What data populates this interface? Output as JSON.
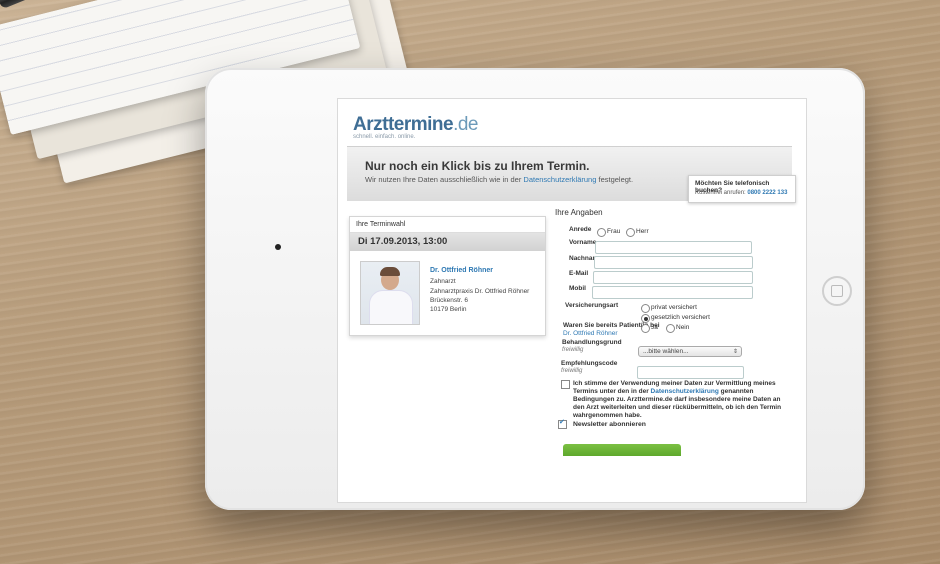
{
  "logo": {
    "brand": "Arzttermine",
    "tld": ".de",
    "tagline": "schnell. einfach. online."
  },
  "banner": {
    "title": "Nur noch ein Klick bis zu Ihrem Termin.",
    "sub_prefix": "Wir nutzen Ihre Daten ausschließlich wie in der",
    "sub_link": "Datenschutzerklärung",
    "sub_suffix": "festgelegt."
  },
  "phone_box": {
    "question": "Möchten Sie telefonisch buchen?",
    "label": "Kostenfrei anrufen:",
    "number": "0800 2222 133"
  },
  "appointment": {
    "header": "Ihre Terminwahl",
    "date": "Di 17.09.2013, 13:00",
    "doctor_name": "Dr. Ottfried Röhner",
    "specialty": "Zahnarzt",
    "practice": "Zahnarztpraxis Dr. Ottfried Röhner",
    "street": "Brückenstr. 6",
    "city": "10179 Berlin"
  },
  "form": {
    "title": "Ihre Angaben",
    "anrede_label": "Anrede",
    "anrede_opt1": "Frau",
    "anrede_opt2": "Herr",
    "vorname_label": "Vorname",
    "nachname_label": "Nachname",
    "email_label": "E-Mail",
    "mobil_label": "Mobil",
    "versicherung_label": "Versicherungsart",
    "versicherung_opt1": "privat versichert",
    "versicherung_opt2": "gesetzlich versichert",
    "patient_q1": "Waren Sie bereits Patient/in bei",
    "patient_q2": "Dr. Ottfried Röhner",
    "patient_yes": "Ja",
    "patient_no": "Nein",
    "behandlung_label": "Behandlungsgrund",
    "behandlung_sub": "freiwillig",
    "behandlung_select": "...bitte wählen...",
    "empfehlung_label": "Empfehlungscode",
    "empfehlung_sub": "freiwillig",
    "consent_1": "Ich stimme der Verwendung meiner Daten zur Vermittlung meines Termins unter den in der",
    "consent_link": "Datenschutzerklärung",
    "consent_2": "genannten Bedingungen zu. Arzttermine.de darf insbesondere meine Daten an den Arzt weiterleiten und dieser rückübermitteln, ob ich den Termin wahrgenommen habe.",
    "newsletter": "Newsletter abonnieren"
  }
}
